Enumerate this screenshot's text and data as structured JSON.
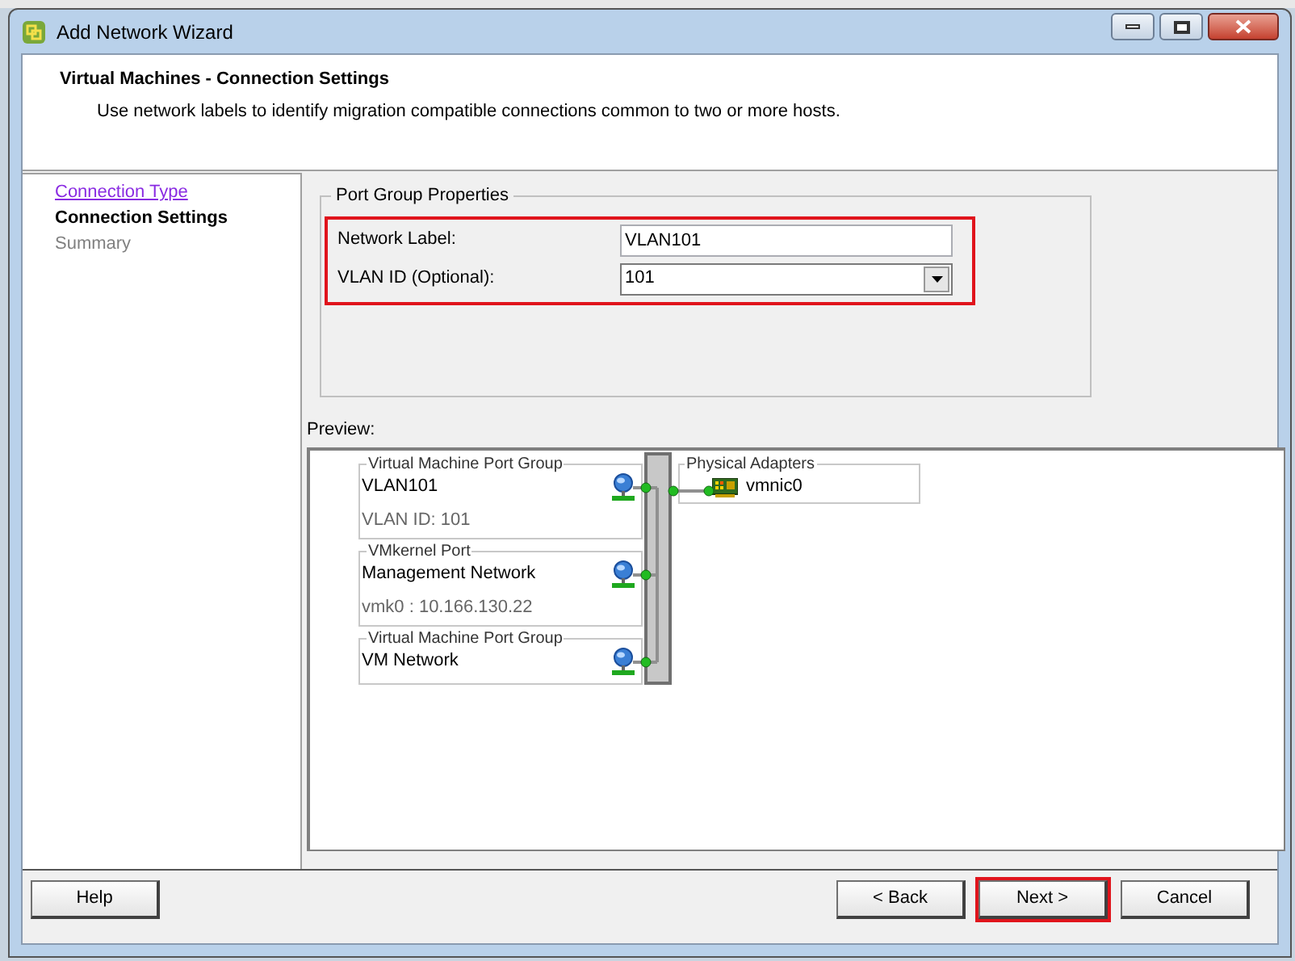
{
  "window": {
    "title": "Add Network Wizard"
  },
  "header": {
    "title": "Virtual Machines - Connection Settings",
    "description": "Use network labels to identify migration compatible connections common to two or more hosts."
  },
  "steps": [
    {
      "label": "Connection Type",
      "selected": false,
      "visited": true
    },
    {
      "label": "Connection Settings",
      "selected": true,
      "visited": false
    },
    {
      "label": "Summary",
      "selected": false,
      "visited": false
    }
  ],
  "port_group_properties": {
    "title": "Port Group Properties",
    "highlighted": true,
    "fields": [
      {
        "label": "Network Label:",
        "kind": "text",
        "value": "VLAN101"
      },
      {
        "label": "VLAN ID (Optional):",
        "kind": "dropdown",
        "value": "101"
      }
    ]
  },
  "preview": {
    "label": "Preview:",
    "port_groups": [
      {
        "type": "Virtual Machine Port Group",
        "name": "VLAN101",
        "detail": "VLAN ID: 101"
      },
      {
        "type": "VMkernel Port",
        "name": "Management Network",
        "detail": "vmk0 : 10.166.130.22"
      },
      {
        "type": "Virtual Machine Port Group",
        "name": "VM Network"
      }
    ],
    "physical_adapters": {
      "title": "Physical Adapters",
      "adapters": [
        "vmnic0"
      ]
    }
  },
  "buttons": [
    {
      "label": "Help",
      "highlighted": false
    },
    {
      "label": "< Back",
      "highlighted": false
    },
    {
      "label": "Next >",
      "highlighted": true
    },
    {
      "label": "Cancel",
      "highlighted": false
    }
  ]
}
